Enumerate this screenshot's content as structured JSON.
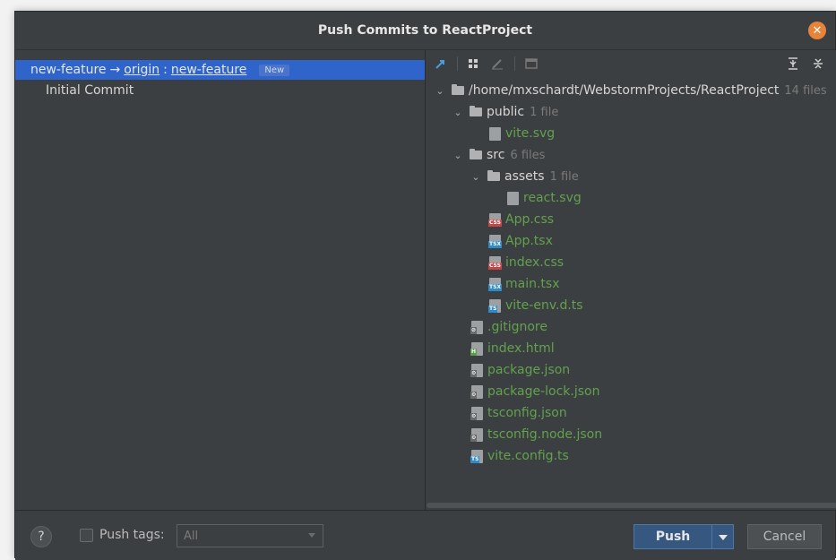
{
  "dialog": {
    "title": "Push Commits to ReactProject",
    "close_icon": "close-icon"
  },
  "left": {
    "branch": {
      "local": "new-feature",
      "arrow": "→",
      "remote": "origin",
      "separator": ":",
      "remote_branch": "new-feature",
      "badge": "New"
    },
    "commits": [
      "Initial Commit"
    ]
  },
  "toolbar": {
    "icons": [
      "push-arrow-icon",
      "group-by-icon",
      "edit-icon",
      "show-diff-icon",
      "expand-all-icon",
      "collapse-all-icon"
    ]
  },
  "tree": {
    "root": {
      "name": "/home/mxschardt/WebstormProjects/ReactProject",
      "count": "14 files"
    },
    "public": {
      "name": "public",
      "count": "1 file",
      "files": [
        "vite.svg"
      ]
    },
    "src": {
      "name": "src",
      "count": "6 files"
    },
    "assets": {
      "name": "assets",
      "count": "1 file",
      "files": [
        "react.svg"
      ]
    },
    "src_files": [
      "App.css",
      "App.tsx",
      "index.css",
      "main.tsx",
      "vite-env.d.ts"
    ],
    "root_files": [
      ".gitignore",
      "index.html",
      "package.json",
      "package-lock.json",
      "tsconfig.json",
      "tsconfig.node.json",
      "vite.config.ts"
    ]
  },
  "bottom": {
    "help": "?",
    "push_tags_label": "Push tags:",
    "tags_value": "All",
    "push_label": "Push",
    "cancel_label": "Cancel"
  },
  "colors": {
    "accent": "#2f65ca",
    "file_green": "#62a14e",
    "close": "#e8833a"
  }
}
